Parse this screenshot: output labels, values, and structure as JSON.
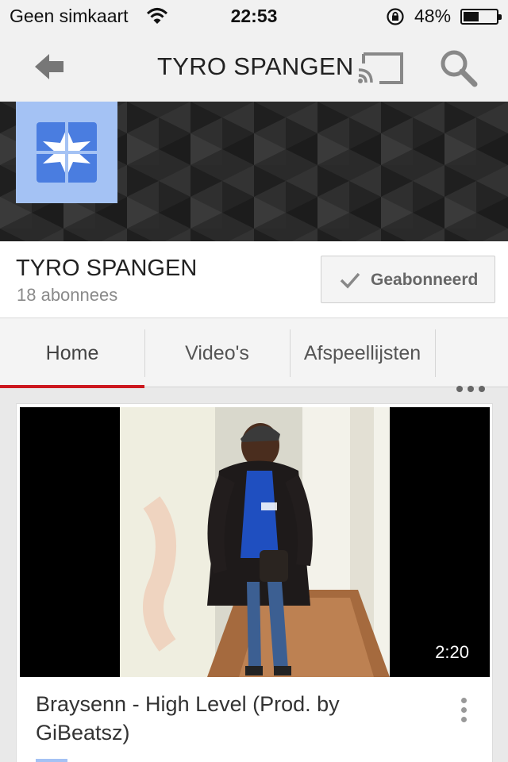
{
  "status_bar": {
    "carrier": "Geen simkaart",
    "time": "22:53",
    "battery_percent": "48%",
    "battery_level": 0.48
  },
  "app_bar": {
    "title": "TYRO SPANGEN",
    "back_icon": "back-arrow-icon",
    "cast_icon": "cast-icon",
    "search_icon": "search-icon"
  },
  "channel": {
    "name": "TYRO SPANGEN",
    "subscribers": "18 abonnees",
    "subscribe_label": "Geabonneerd",
    "avatar_color": "#a4c2f4",
    "avatar_icon_color": "#4a7de0"
  },
  "tabs": [
    {
      "label": "Home",
      "active": true
    },
    {
      "label": "Video's",
      "active": false
    },
    {
      "label": "Afspeellijsten",
      "active": false
    }
  ],
  "accent_color": "#cc181e",
  "video": {
    "title": "Braysenn - High Level (Prod. by GiBeatsz)",
    "duration": "2:20"
  }
}
